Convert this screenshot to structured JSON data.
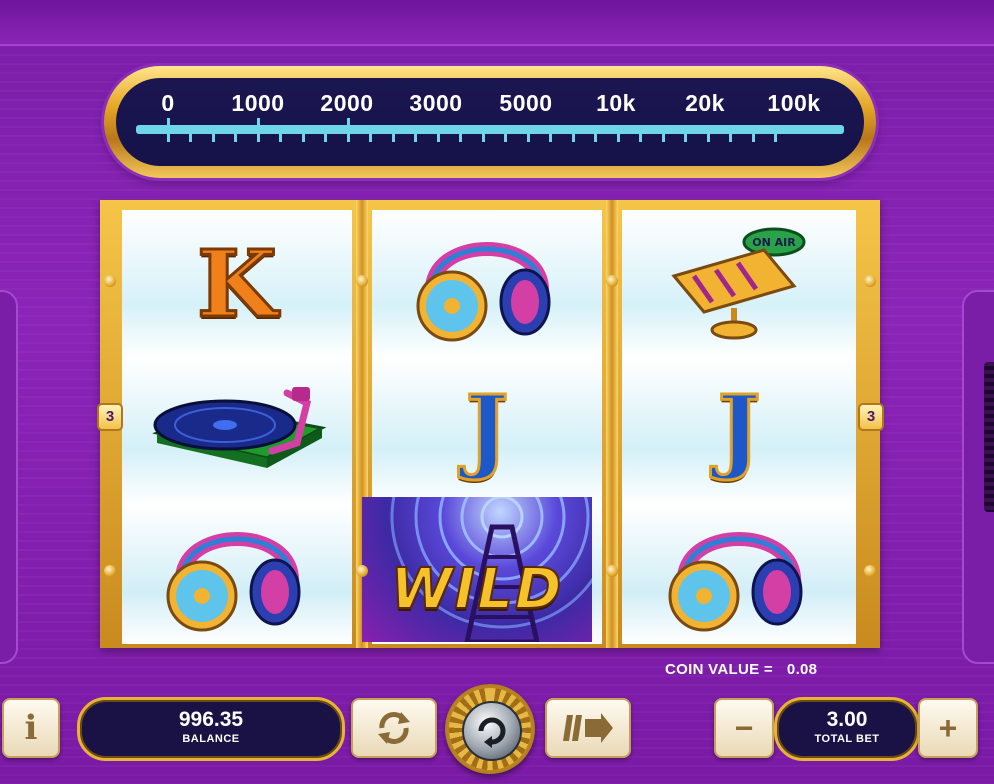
{
  "dial": {
    "labels": [
      "0",
      "1000",
      "2000",
      "3000",
      "5000",
      "10k",
      "20k",
      "100k"
    ]
  },
  "reels": {
    "side_badge_left": "3",
    "side_badge_right": "3",
    "symbols": [
      [
        "K",
        "turntable",
        "headphones"
      ],
      [
        "headphones",
        "J",
        "WILD"
      ],
      [
        "on-air-microphone",
        "J",
        "headphones"
      ]
    ],
    "k_letter": "K",
    "j_letter": "J",
    "wild_text": "WILD",
    "mic_sign": "ON AIR"
  },
  "footer": {
    "coin_value_label": "COIN VALUE =",
    "coin_value": "0.08",
    "balance_value": "996.35",
    "balance_label": "BALANCE",
    "total_bet_value": "3.00",
    "total_bet_label": "TOTAL BET",
    "info_label": "i",
    "minus_label": "−",
    "plus_label": "+"
  },
  "icons": {
    "autoplay": "refresh-icon",
    "turbo": "fast-forward-icon",
    "spin": "spin-icon"
  },
  "colors": {
    "background": "#7a1ea8",
    "gold": "#e7a928",
    "dial_scale": "#6fd6ea",
    "pill_bg": "#1a1245"
  }
}
